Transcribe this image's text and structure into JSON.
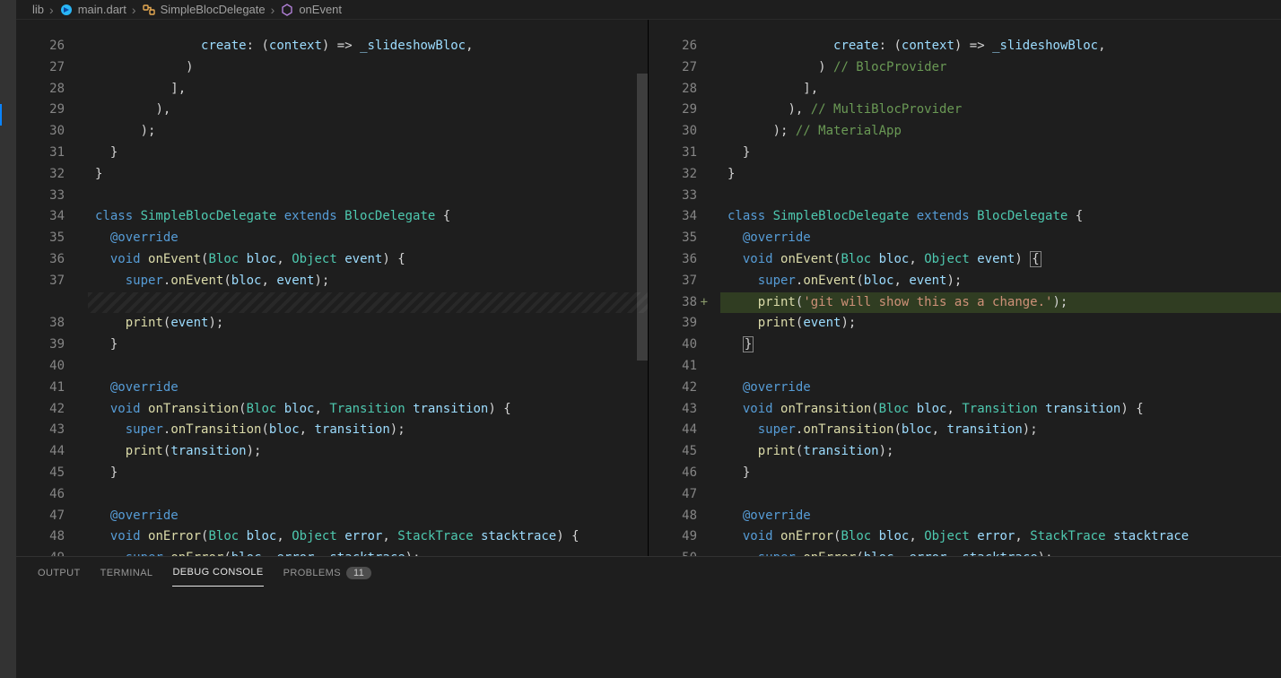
{
  "breadcrumb": {
    "folder": "lib",
    "file": "main.dart",
    "class": "SimpleBlocDelegate",
    "method": "onEvent"
  },
  "left": {
    "lines": [
      {
        "n": "26",
        "tokens": [
          [
            "plain",
            "              "
          ],
          [
            "id",
            "create"
          ],
          [
            "punct",
            ": ("
          ],
          [
            "id",
            "context"
          ],
          [
            "punct",
            ") => "
          ],
          [
            "id",
            "_slideshowBloc"
          ],
          [
            "punct",
            ","
          ]
        ]
      },
      {
        "n": "27",
        "tokens": [
          [
            "plain",
            "            "
          ],
          [
            "punct",
            ")"
          ]
        ]
      },
      {
        "n": "28",
        "tokens": [
          [
            "plain",
            "          "
          ],
          [
            "punct",
            "],"
          ]
        ]
      },
      {
        "n": "29",
        "tokens": [
          [
            "plain",
            "        "
          ],
          [
            "punct",
            "),"
          ]
        ]
      },
      {
        "n": "30",
        "tokens": [
          [
            "plain",
            "      "
          ],
          [
            "punct",
            ");"
          ]
        ]
      },
      {
        "n": "31",
        "tokens": [
          [
            "plain",
            "  "
          ],
          [
            "punct",
            "}"
          ]
        ]
      },
      {
        "n": "32",
        "tokens": [
          [
            "punct",
            "}"
          ]
        ]
      },
      {
        "n": "33",
        "tokens": []
      },
      {
        "n": "34",
        "tokens": [
          [
            "kw",
            "class "
          ],
          [
            "type",
            "SimpleBlocDelegate "
          ],
          [
            "kw",
            "extends "
          ],
          [
            "type",
            "BlocDelegate "
          ],
          [
            "punct",
            "{"
          ]
        ]
      },
      {
        "n": "35",
        "tokens": [
          [
            "plain",
            "  "
          ],
          [
            "ann",
            "@override"
          ]
        ]
      },
      {
        "n": "36",
        "tokens": [
          [
            "plain",
            "  "
          ],
          [
            "kw",
            "void "
          ],
          [
            "fn",
            "onEvent"
          ],
          [
            "punct",
            "("
          ],
          [
            "type",
            "Bloc "
          ],
          [
            "id",
            "bloc"
          ],
          [
            "punct",
            ", "
          ],
          [
            "type",
            "Object "
          ],
          [
            "id",
            "event"
          ],
          [
            "punct",
            ") {"
          ]
        ]
      },
      {
        "n": "37",
        "tokens": [
          [
            "plain",
            "    "
          ],
          [
            "super",
            "super"
          ],
          [
            "punct",
            "."
          ],
          [
            "fn",
            "onEvent"
          ],
          [
            "punct",
            "("
          ],
          [
            "id",
            "bloc"
          ],
          [
            "punct",
            ", "
          ],
          [
            "id",
            "event"
          ],
          [
            "punct",
            ");"
          ]
        ]
      },
      {
        "n": "",
        "hatch": true,
        "tokens": []
      },
      {
        "n": "38",
        "tokens": [
          [
            "plain",
            "    "
          ],
          [
            "fn",
            "print"
          ],
          [
            "punct",
            "("
          ],
          [
            "id",
            "event"
          ],
          [
            "punct",
            ");"
          ]
        ]
      },
      {
        "n": "39",
        "tokens": [
          [
            "plain",
            "  "
          ],
          [
            "punct",
            "}"
          ]
        ]
      },
      {
        "n": "40",
        "tokens": []
      },
      {
        "n": "41",
        "tokens": [
          [
            "plain",
            "  "
          ],
          [
            "ann",
            "@override"
          ]
        ]
      },
      {
        "n": "42",
        "tokens": [
          [
            "plain",
            "  "
          ],
          [
            "kw",
            "void "
          ],
          [
            "fn",
            "onTransition"
          ],
          [
            "punct",
            "("
          ],
          [
            "type",
            "Bloc "
          ],
          [
            "id",
            "bloc"
          ],
          [
            "punct",
            ", "
          ],
          [
            "type",
            "Transition "
          ],
          [
            "id",
            "transition"
          ],
          [
            "punct",
            ") {"
          ]
        ]
      },
      {
        "n": "43",
        "tokens": [
          [
            "plain",
            "    "
          ],
          [
            "super",
            "super"
          ],
          [
            "punct",
            "."
          ],
          [
            "fn",
            "onTransition"
          ],
          [
            "punct",
            "("
          ],
          [
            "id",
            "bloc"
          ],
          [
            "punct",
            ", "
          ],
          [
            "id",
            "transition"
          ],
          [
            "punct",
            ");"
          ]
        ]
      },
      {
        "n": "44",
        "tokens": [
          [
            "plain",
            "    "
          ],
          [
            "fn",
            "print"
          ],
          [
            "punct",
            "("
          ],
          [
            "id",
            "transition"
          ],
          [
            "punct",
            ");"
          ]
        ]
      },
      {
        "n": "45",
        "tokens": [
          [
            "plain",
            "  "
          ],
          [
            "punct",
            "}"
          ]
        ]
      },
      {
        "n": "46",
        "tokens": []
      },
      {
        "n": "47",
        "tokens": [
          [
            "plain",
            "  "
          ],
          [
            "ann",
            "@override"
          ]
        ]
      },
      {
        "n": "48",
        "tokens": [
          [
            "plain",
            "  "
          ],
          [
            "kw",
            "void "
          ],
          [
            "fn",
            "onError"
          ],
          [
            "punct",
            "("
          ],
          [
            "type",
            "Bloc "
          ],
          [
            "id",
            "bloc"
          ],
          [
            "punct",
            ", "
          ],
          [
            "type",
            "Object "
          ],
          [
            "id",
            "error"
          ],
          [
            "punct",
            ", "
          ],
          [
            "type",
            "StackTrace "
          ],
          [
            "id",
            "stacktrace"
          ],
          [
            "punct",
            ") {"
          ]
        ]
      },
      {
        "n": "49",
        "tokens": [
          [
            "plain",
            "    "
          ],
          [
            "super",
            "super"
          ],
          [
            "punct",
            "."
          ],
          [
            "fn",
            "onError"
          ],
          [
            "punct",
            "("
          ],
          [
            "id",
            "bloc"
          ],
          [
            "punct",
            ", "
          ],
          [
            "id",
            "error"
          ],
          [
            "punct",
            ", "
          ],
          [
            "id",
            "stacktrace"
          ],
          [
            "punct",
            ");"
          ]
        ]
      }
    ]
  },
  "right": {
    "lines": [
      {
        "n": "26",
        "tokens": [
          [
            "plain",
            "              "
          ],
          [
            "id",
            "create"
          ],
          [
            "punct",
            ": ("
          ],
          [
            "id",
            "context"
          ],
          [
            "punct",
            ") => "
          ],
          [
            "id",
            "_slideshowBloc"
          ],
          [
            "punct",
            ","
          ]
        ]
      },
      {
        "n": "27",
        "tokens": [
          [
            "plain",
            "            "
          ],
          [
            "punct",
            ") "
          ],
          [
            "cmt",
            "// BlocProvider"
          ]
        ]
      },
      {
        "n": "28",
        "tokens": [
          [
            "plain",
            "          "
          ],
          [
            "punct",
            "],"
          ]
        ]
      },
      {
        "n": "29",
        "tokens": [
          [
            "plain",
            "        "
          ],
          [
            "punct",
            "), "
          ],
          [
            "cmt",
            "// MultiBlocProvider"
          ]
        ]
      },
      {
        "n": "30",
        "tokens": [
          [
            "plain",
            "      "
          ],
          [
            "punct",
            "); "
          ],
          [
            "cmt",
            "// MaterialApp"
          ]
        ]
      },
      {
        "n": "31",
        "tokens": [
          [
            "plain",
            "  "
          ],
          [
            "punct",
            "}"
          ]
        ]
      },
      {
        "n": "32",
        "tokens": [
          [
            "punct",
            "}"
          ]
        ]
      },
      {
        "n": "33",
        "tokens": []
      },
      {
        "n": "34",
        "tokens": [
          [
            "kw",
            "class "
          ],
          [
            "type",
            "SimpleBlocDelegate "
          ],
          [
            "kw",
            "extends "
          ],
          [
            "type",
            "BlocDelegate "
          ],
          [
            "punct",
            "{"
          ]
        ]
      },
      {
        "n": "35",
        "tokens": [
          [
            "plain",
            "  "
          ],
          [
            "ann",
            "@override"
          ]
        ]
      },
      {
        "n": "36",
        "bracketEnd": true,
        "tokens": [
          [
            "plain",
            "  "
          ],
          [
            "kw",
            "void "
          ],
          [
            "fn",
            "onEvent"
          ],
          [
            "punct",
            "("
          ],
          [
            "type",
            "Bloc "
          ],
          [
            "id",
            "bloc"
          ],
          [
            "punct",
            ", "
          ],
          [
            "type",
            "Object "
          ],
          [
            "id",
            "event"
          ],
          [
            "punct",
            ") "
          ]
        ]
      },
      {
        "n": "37",
        "tokens": [
          [
            "plain",
            "    "
          ],
          [
            "super",
            "super"
          ],
          [
            "punct",
            "."
          ],
          [
            "fn",
            "onEvent"
          ],
          [
            "punct",
            "("
          ],
          [
            "id",
            "bloc"
          ],
          [
            "punct",
            ", "
          ],
          [
            "id",
            "event"
          ],
          [
            "punct",
            ");"
          ]
        ]
      },
      {
        "n": "38",
        "added": true,
        "tokens": [
          [
            "plain",
            "    "
          ],
          [
            "fn",
            "print"
          ],
          [
            "punct",
            "("
          ],
          [
            "str",
            "'git will show this as a change.'"
          ],
          [
            "punct",
            ");"
          ]
        ]
      },
      {
        "n": "39",
        "tokens": [
          [
            "plain",
            "    "
          ],
          [
            "fn",
            "print"
          ],
          [
            "punct",
            "("
          ],
          [
            "id",
            "event"
          ],
          [
            "punct",
            ");"
          ]
        ]
      },
      {
        "n": "40",
        "bracketLine": true,
        "tokens": [
          [
            "plain",
            "  "
          ]
        ]
      },
      {
        "n": "41",
        "tokens": []
      },
      {
        "n": "42",
        "tokens": [
          [
            "plain",
            "  "
          ],
          [
            "ann",
            "@override"
          ]
        ]
      },
      {
        "n": "43",
        "tokens": [
          [
            "plain",
            "  "
          ],
          [
            "kw",
            "void "
          ],
          [
            "fn",
            "onTransition"
          ],
          [
            "punct",
            "("
          ],
          [
            "type",
            "Bloc "
          ],
          [
            "id",
            "bloc"
          ],
          [
            "punct",
            ", "
          ],
          [
            "type",
            "Transition "
          ],
          [
            "id",
            "transition"
          ],
          [
            "punct",
            ") {"
          ]
        ]
      },
      {
        "n": "44",
        "tokens": [
          [
            "plain",
            "    "
          ],
          [
            "super",
            "super"
          ],
          [
            "punct",
            "."
          ],
          [
            "fn",
            "onTransition"
          ],
          [
            "punct",
            "("
          ],
          [
            "id",
            "bloc"
          ],
          [
            "punct",
            ", "
          ],
          [
            "id",
            "transition"
          ],
          [
            "punct",
            ");"
          ]
        ]
      },
      {
        "n": "45",
        "tokens": [
          [
            "plain",
            "    "
          ],
          [
            "fn",
            "print"
          ],
          [
            "punct",
            "("
          ],
          [
            "id",
            "transition"
          ],
          [
            "punct",
            ");"
          ]
        ]
      },
      {
        "n": "46",
        "tokens": [
          [
            "plain",
            "  "
          ],
          [
            "punct",
            "}"
          ]
        ]
      },
      {
        "n": "47",
        "tokens": []
      },
      {
        "n": "48",
        "tokens": [
          [
            "plain",
            "  "
          ],
          [
            "ann",
            "@override"
          ]
        ]
      },
      {
        "n": "49",
        "tokens": [
          [
            "plain",
            "  "
          ],
          [
            "kw",
            "void "
          ],
          [
            "fn",
            "onError"
          ],
          [
            "punct",
            "("
          ],
          [
            "type",
            "Bloc "
          ],
          [
            "id",
            "bloc"
          ],
          [
            "punct",
            ", "
          ],
          [
            "type",
            "Object "
          ],
          [
            "id",
            "error"
          ],
          [
            "punct",
            ", "
          ],
          [
            "type",
            "StackTrace "
          ],
          [
            "id",
            "stacktrace"
          ]
        ]
      },
      {
        "n": "50",
        "tokens": [
          [
            "plain",
            "    "
          ],
          [
            "super",
            "super"
          ],
          [
            "punct",
            "."
          ],
          [
            "fn",
            "onError"
          ],
          [
            "punct",
            "("
          ],
          [
            "id",
            "bloc"
          ],
          [
            "punct",
            ", "
          ],
          [
            "id",
            "error"
          ],
          [
            "punct",
            ", "
          ],
          [
            "id",
            "stacktrace"
          ],
          [
            "punct",
            ");"
          ]
        ]
      }
    ]
  },
  "panel": {
    "tabs": {
      "output": "OUTPUT",
      "terminal": "TERMINAL",
      "debug": "DEBUG CONSOLE",
      "problems": "PROBLEMS",
      "problemsCount": "11"
    }
  }
}
